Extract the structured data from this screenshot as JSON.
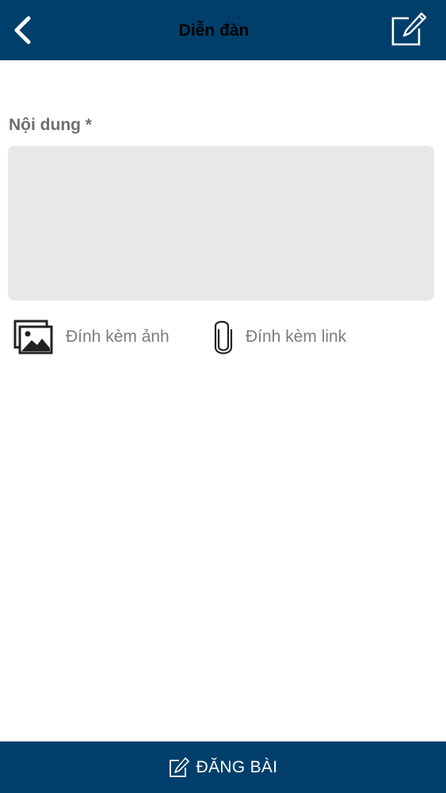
{
  "header": {
    "title": "Diễn đàn",
    "back_icon": "chevron-left-icon",
    "compose_icon": "edit-icon"
  },
  "form": {
    "content_label": "Nội dung *",
    "content_value": "",
    "content_placeholder": ""
  },
  "attachments": {
    "photo_label": "Đính kèm ảnh",
    "photo_icon": "image-icon",
    "link_label": "Đính kèm link",
    "link_icon": "paperclip-icon"
  },
  "footer": {
    "post_label": "ĐĂNG BÀI",
    "post_icon": "edit-icon"
  },
  "colors": {
    "primary": "#003f6b",
    "input_bg": "#e9e8e9",
    "label_gray": "#6f6f6f"
  }
}
